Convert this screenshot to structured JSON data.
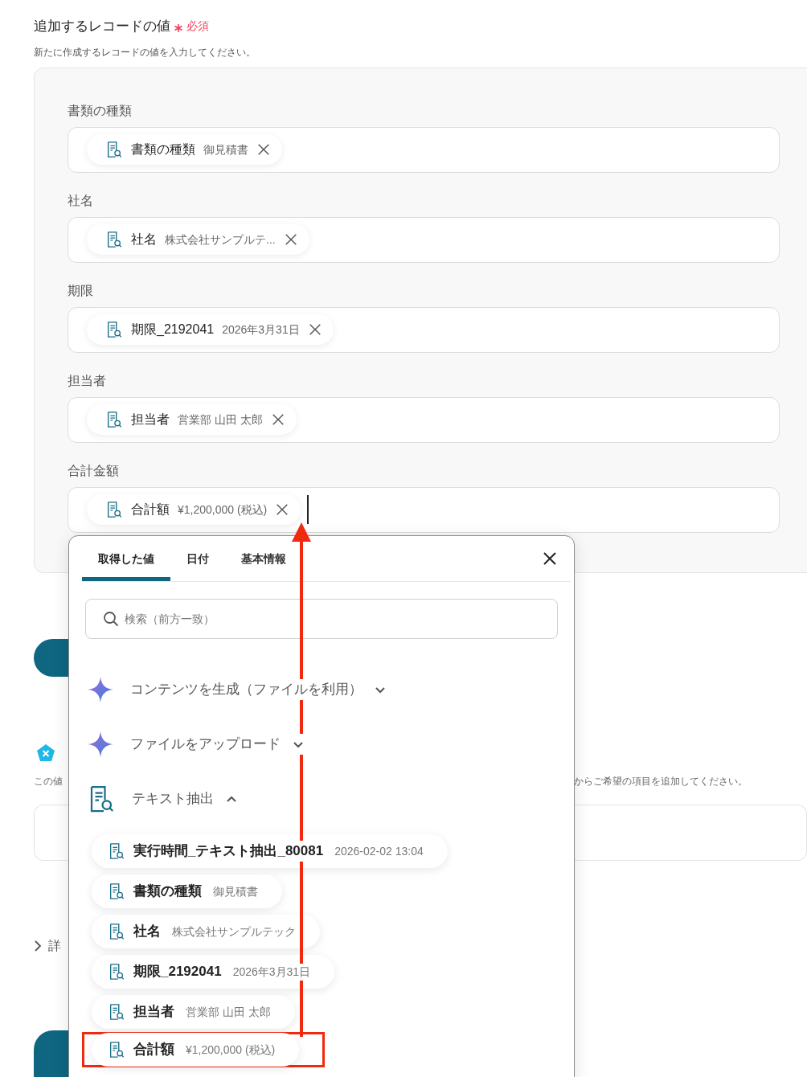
{
  "section": {
    "title": "追加するレコードの値",
    "required_label": "必須",
    "description": "新たに作成するレコードの値を入力してください。"
  },
  "fields": [
    {
      "label": "書類の種類",
      "chip": {
        "name": "書類の種類",
        "value": "御見積書"
      },
      "focused": false
    },
    {
      "label": "社名",
      "chip": {
        "name": "社名",
        "value": "株式会社サンプルテ..."
      },
      "focused": false
    },
    {
      "label": "期限",
      "chip": {
        "name": "期限_2192041",
        "value": "2026年3月31日"
      },
      "focused": false
    },
    {
      "label": "担当者",
      "chip": {
        "name": "担当者",
        "value": "営業部 山田 太郎"
      },
      "focused": false
    },
    {
      "label": "合計金額",
      "chip": {
        "name": "合計額",
        "value": "¥1,200,000 (税込)"
      },
      "focused": true
    }
  ],
  "background": {
    "hint_start": "この値",
    "hint_end": "からご希望の項目を追加してください。",
    "details_label": "詳"
  },
  "popup": {
    "tabs": [
      {
        "label": "取得した値",
        "selected": true
      },
      {
        "label": "日付",
        "selected": false
      },
      {
        "label": "基本情報",
        "selected": false
      }
    ],
    "search": {
      "placeholder": "検索（前方一致）"
    },
    "groups": [
      {
        "kind": "ai",
        "label": "コンテンツを生成（ファイルを利用）",
        "expanded": false
      },
      {
        "kind": "ai",
        "label": "ファイルをアップロード",
        "expanded": false
      },
      {
        "kind": "extract",
        "label": "テキスト抽出",
        "expanded": true,
        "items": [
          {
            "name": "実行時間_テキスト抽出_80081",
            "value": "2026-02-02 13:04",
            "highlighted": false
          },
          {
            "name": "書類の種類",
            "value": "御見積書",
            "highlighted": false
          },
          {
            "name": "社名",
            "value": "株式会社サンプルテック",
            "highlighted": false
          },
          {
            "name": "期限_2192041",
            "value": "2026年3月31日",
            "highlighted": false
          },
          {
            "name": "担当者",
            "value": "営業部 山田 太郎",
            "highlighted": false
          },
          {
            "name": "合計額",
            "value": "¥1,200,000 (税込)",
            "highlighted": true
          }
        ]
      }
    ]
  }
}
